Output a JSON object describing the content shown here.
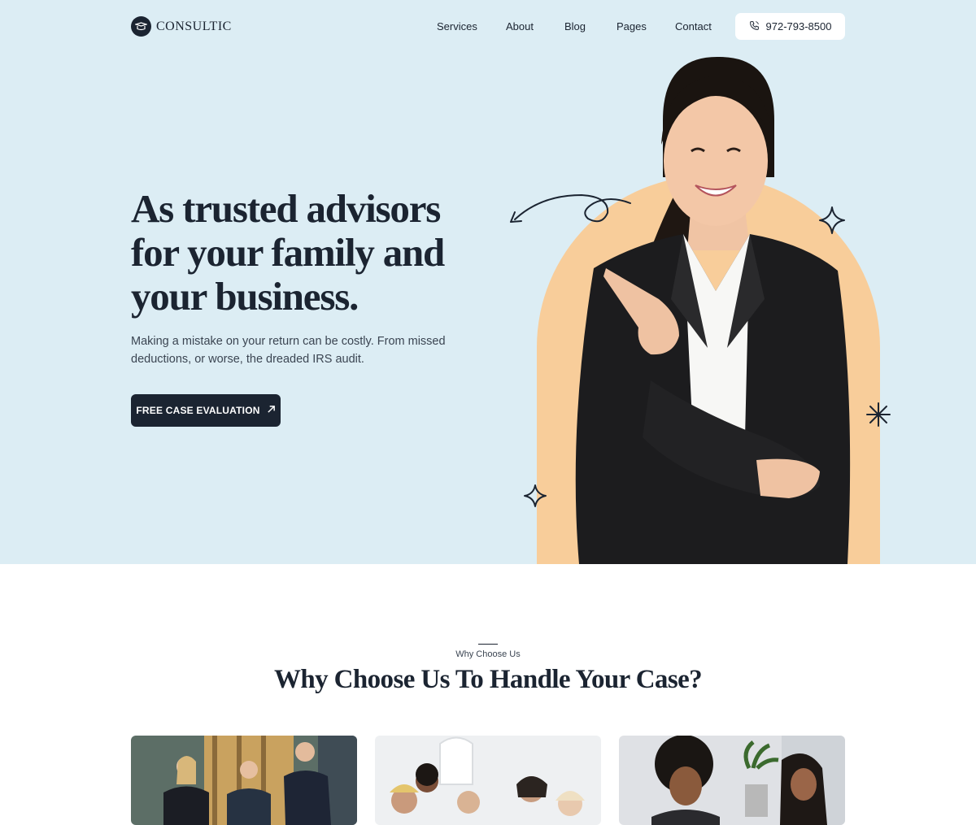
{
  "brand": {
    "name": "CONSULTIC"
  },
  "nav": {
    "items": [
      {
        "label": "Services"
      },
      {
        "label": "About"
      },
      {
        "label": "Blog"
      },
      {
        "label": "Pages"
      },
      {
        "label": "Contact"
      }
    ],
    "phone": "972-793-8500"
  },
  "hero": {
    "title": "As trusted advisors for your family and your business.",
    "subtitle": "Making a mistake on your return can be costly. From missed deductions, or worse, the dreaded IRS audit.",
    "cta_label": "FREE CASE EVALUATION"
  },
  "why": {
    "eyebrow": "Why Choose Us",
    "title": "Why Choose Us To Handle Your Case?"
  },
  "colors": {
    "hero_bg": "#dcedf4",
    "primary": "#1b2431",
    "accent": "#f8cd9a"
  },
  "icons": [
    "logo-icon",
    "phone-icon",
    "arrow-up-right-icon",
    "curved-arrow-icon",
    "sparkle-icon",
    "asterisk-icon"
  ]
}
